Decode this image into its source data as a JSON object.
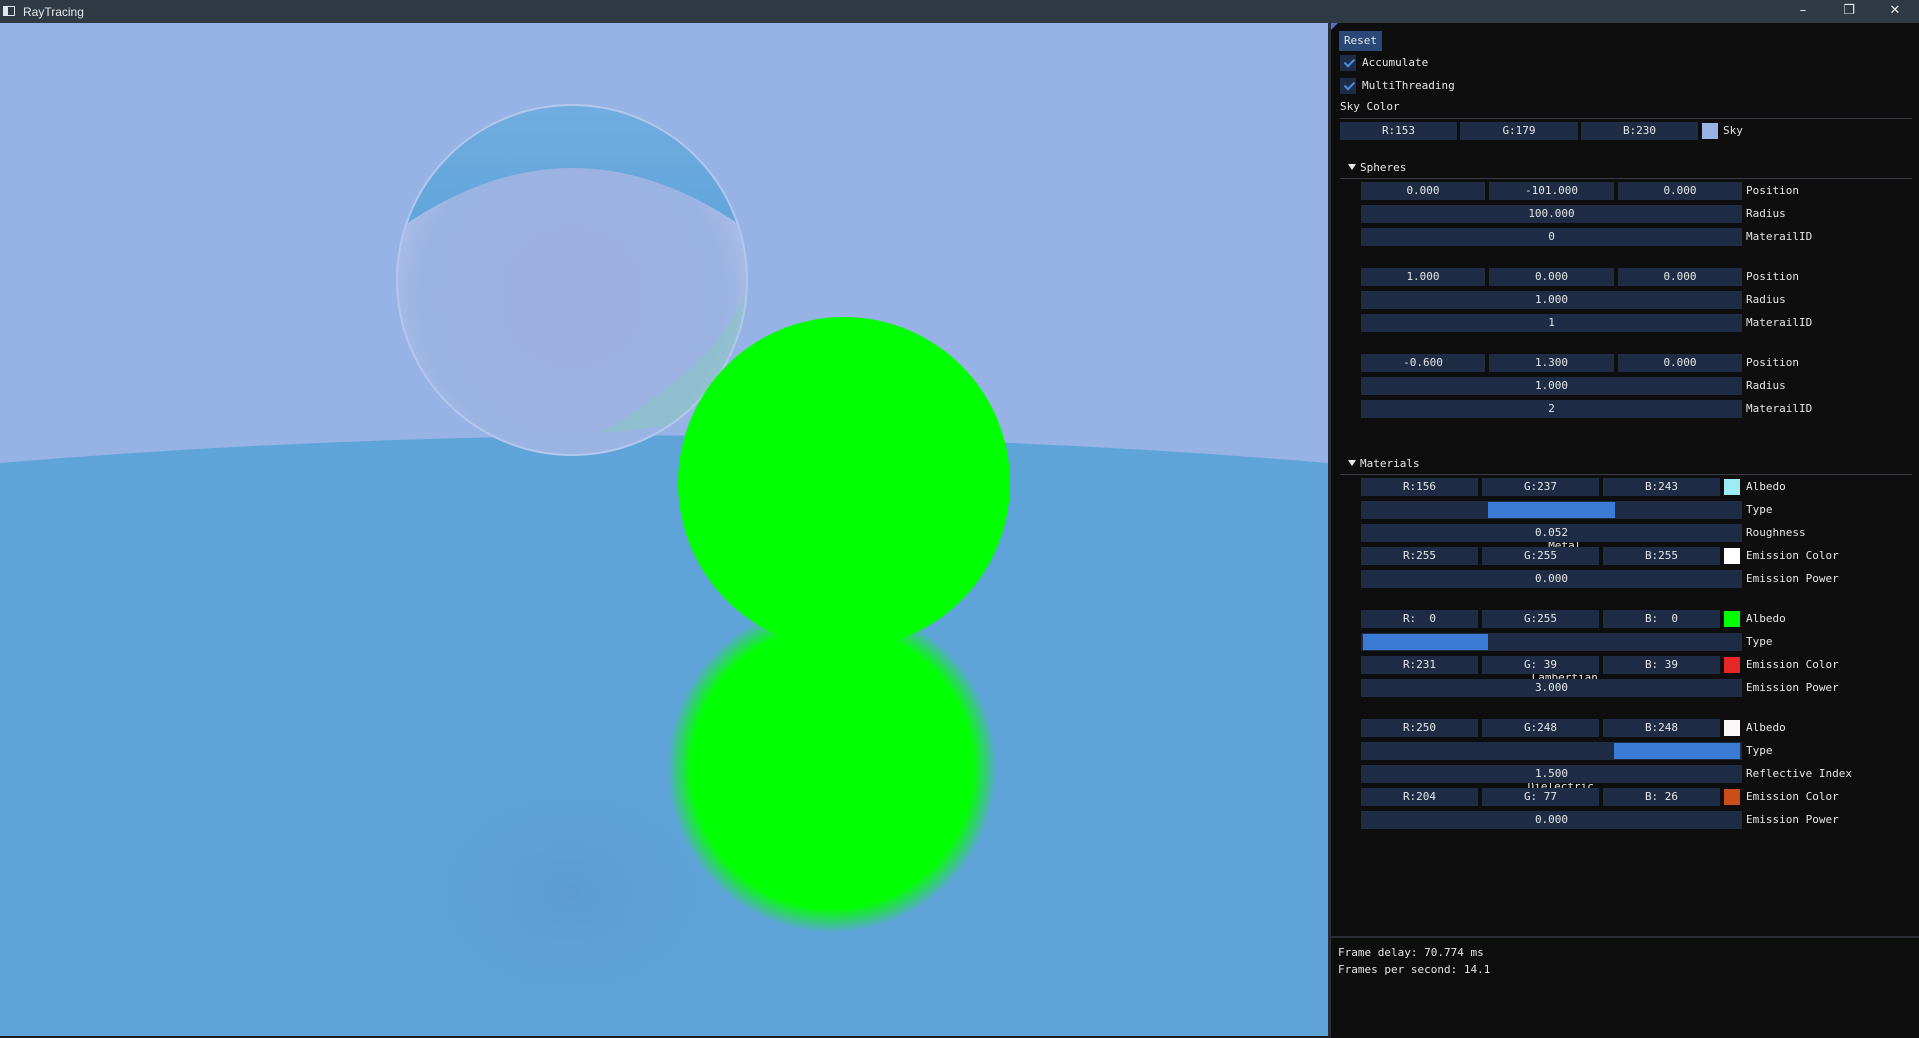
{
  "window": {
    "title": "RayTracing"
  },
  "sky_color": "#99b3e6",
  "panel": {
    "reset_label": "Reset",
    "accumulate_label": "Accumulate",
    "multithreading_label": "MultiThreading",
    "sky_color_heading": "Sky Color",
    "sky": {
      "r": "R:153",
      "g": "G:179",
      "b": "B:230",
      "label": "Sky",
      "swatch": "#99b3e6"
    },
    "spheres_heading": "Spheres",
    "spheres": [
      {
        "px": "0.000",
        "py": "-101.000",
        "pz": "0.000",
        "position_label": "Position",
        "radius": "100.000",
        "radius_label": "Radius",
        "material": "0",
        "material_label": "MaterailID"
      },
      {
        "px": "1.000",
        "py": "0.000",
        "pz": "0.000",
        "position_label": "Position",
        "radius": "1.000",
        "radius_label": "Radius",
        "material": "1",
        "material_label": "MaterailID"
      },
      {
        "px": "-0.600",
        "py": "1.300",
        "pz": "0.000",
        "position_label": "Position",
        "radius": "1.000",
        "radius_label": "Radius",
        "material": "2",
        "material_label": "MaterailID"
      }
    ],
    "materials_heading": "Materials",
    "materials": [
      {
        "albedo": {
          "r": "R:156",
          "g": "G:237",
          "b": "B:243",
          "label": "Albedo",
          "swatch": "#9cedf3"
        },
        "type": {
          "value": "Metal",
          "label": "Type"
        },
        "roughness": {
          "value": "0.052",
          "label": "Roughness"
        },
        "emission_color": {
          "r": "R:255",
          "g": "G:255",
          "b": "B:255",
          "label": "Emission Color",
          "swatch": "#ffffff"
        },
        "emission_power": {
          "value": "0.000",
          "label": "Emission Power"
        }
      },
      {
        "albedo": {
          "r": "R:  0",
          "g": "G:255",
          "b": "B:  0",
          "label": "Albedo",
          "swatch": "#00ff00"
        },
        "type": {
          "value": "Lambertian",
          "label": "Type"
        },
        "emission_color": {
          "r": "R:231",
          "g": "G: 39",
          "b": "B: 39",
          "label": "Emission Color",
          "swatch": "#e72727"
        },
        "emission_power": {
          "value": "3.000",
          "label": "Emission Power"
        }
      },
      {
        "albedo": {
          "r": "R:250",
          "g": "G:248",
          "b": "B:248",
          "label": "Albedo",
          "swatch": "#faf8f8"
        },
        "type": {
          "value": "Dielectric",
          "label": "Type"
        },
        "reflective_index": {
          "value": "1.500",
          "label": "Reflective Index"
        },
        "emission_color": {
          "r": "R:204",
          "g": "G: 77",
          "b": "B: 26",
          "label": "Emission Color",
          "swatch": "#cc4d1a"
        },
        "emission_power": {
          "value": "0.000",
          "label": "Emission Power"
        }
      }
    ]
  },
  "stats": {
    "frame_delay": "Frame delay: 70.774 ms",
    "fps": "Frames per second: 14.1"
  }
}
